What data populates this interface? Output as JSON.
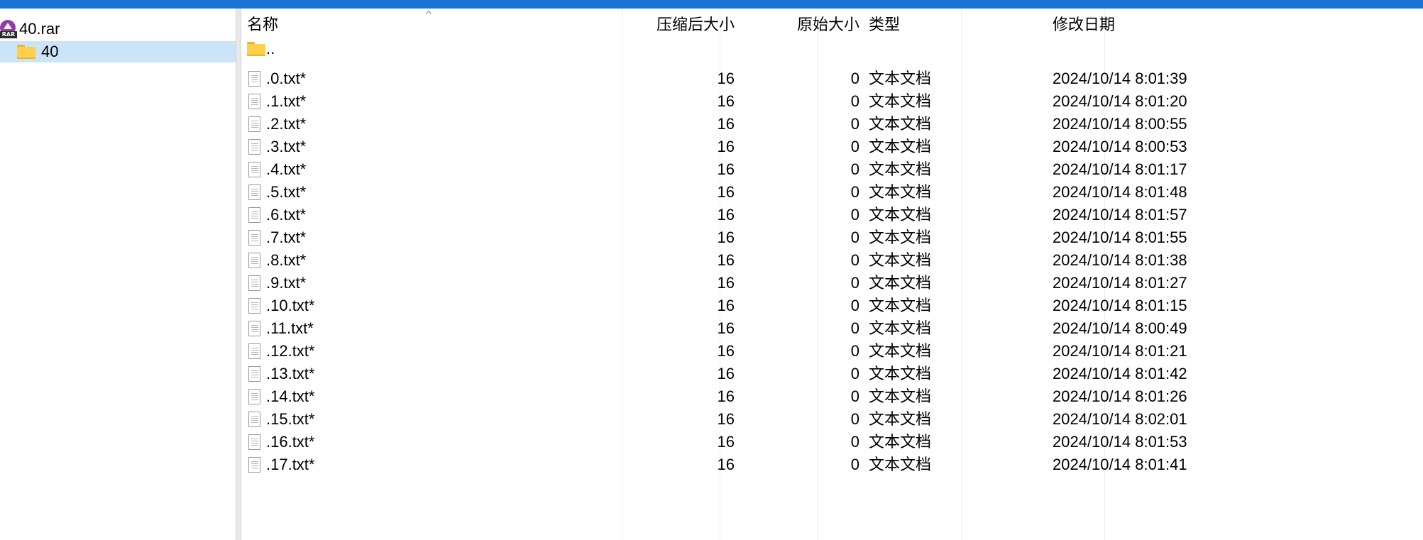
{
  "tree": {
    "root_label": "40.rar",
    "root_icon": "rar-archive-icon",
    "rar_tag": "RAR",
    "child_label": "40",
    "child_icon": "folder-icon"
  },
  "columns": {
    "name": "名称",
    "packed_size": "压缩后大小",
    "size": "原始大小",
    "type": "类型",
    "modified": "修改日期",
    "sort_indicator": "^"
  },
  "parent_row": {
    "name": "..",
    "icon": "folder-icon"
  },
  "files": [
    {
      "name": ".0.txt*",
      "packed": "16",
      "size": "0",
      "type": "文本文档",
      "modified": "2024/10/14 8:01:39"
    },
    {
      "name": ".1.txt*",
      "packed": "16",
      "size": "0",
      "type": "文本文档",
      "modified": "2024/10/14 8:01:20"
    },
    {
      "name": ".2.txt*",
      "packed": "16",
      "size": "0",
      "type": "文本文档",
      "modified": "2024/10/14 8:00:55"
    },
    {
      "name": ".3.txt*",
      "packed": "16",
      "size": "0",
      "type": "文本文档",
      "modified": "2024/10/14 8:00:53"
    },
    {
      "name": ".4.txt*",
      "packed": "16",
      "size": "0",
      "type": "文本文档",
      "modified": "2024/10/14 8:01:17"
    },
    {
      "name": ".5.txt*",
      "packed": "16",
      "size": "0",
      "type": "文本文档",
      "modified": "2024/10/14 8:01:48"
    },
    {
      "name": ".6.txt*",
      "packed": "16",
      "size": "0",
      "type": "文本文档",
      "modified": "2024/10/14 8:01:57"
    },
    {
      "name": ".7.txt*",
      "packed": "16",
      "size": "0",
      "type": "文本文档",
      "modified": "2024/10/14 8:01:55"
    },
    {
      "name": ".8.txt*",
      "packed": "16",
      "size": "0",
      "type": "文本文档",
      "modified": "2024/10/14 8:01:38"
    },
    {
      "name": ".9.txt*",
      "packed": "16",
      "size": "0",
      "type": "文本文档",
      "modified": "2024/10/14 8:01:27"
    },
    {
      "name": ".10.txt*",
      "packed": "16",
      "size": "0",
      "type": "文本文档",
      "modified": "2024/10/14 8:01:15"
    },
    {
      "name": ".11.txt*",
      "packed": "16",
      "size": "0",
      "type": "文本文档",
      "modified": "2024/10/14 8:00:49"
    },
    {
      "name": ".12.txt*",
      "packed": "16",
      "size": "0",
      "type": "文本文档",
      "modified": "2024/10/14 8:01:21"
    },
    {
      "name": ".13.txt*",
      "packed": "16",
      "size": "0",
      "type": "文本文档",
      "modified": "2024/10/14 8:01:42"
    },
    {
      "name": ".14.txt*",
      "packed": "16",
      "size": "0",
      "type": "文本文档",
      "modified": "2024/10/14 8:01:26"
    },
    {
      "name": ".15.txt*",
      "packed": "16",
      "size": "0",
      "type": "文本文档",
      "modified": "2024/10/14 8:02:01"
    },
    {
      "name": ".16.txt*",
      "packed": "16",
      "size": "0",
      "type": "文本文档",
      "modified": "2024/10/14 8:01:53"
    },
    {
      "name": ".17.txt*",
      "packed": "16",
      "size": "0",
      "type": "文本文档",
      "modified": "2024/10/14 8:01:41"
    }
  ],
  "file_icon": "text-file-icon",
  "colors": {
    "title_bar": "#1a73d6",
    "selection": "#cce4f7",
    "folder": "#ffd04a"
  }
}
